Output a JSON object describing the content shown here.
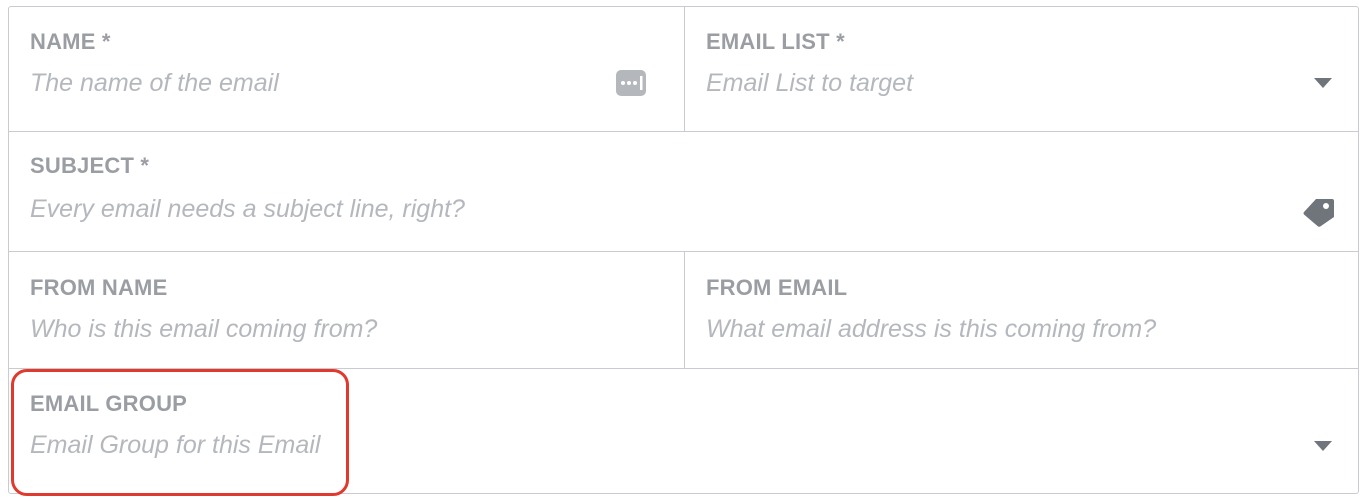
{
  "form": {
    "name": {
      "label": "NAME *",
      "placeholder": "The name of the email",
      "icon": "text-field-icon"
    },
    "email_list": {
      "label": "EMAIL LIST *",
      "placeholder": "Email List to target",
      "icon": "chevron-down-icon"
    },
    "subject": {
      "label": "SUBJECT *",
      "placeholder": "Every email needs a subject line, right?",
      "icon": "tag-icon"
    },
    "from_name": {
      "label": "FROM NAME",
      "placeholder": "Who is this email coming from?"
    },
    "from_email": {
      "label": "FROM EMAIL",
      "placeholder": "What email address is this coming from?"
    },
    "email_group": {
      "label": "EMAIL GROUP",
      "placeholder": "Email Group for this Email",
      "icon": "chevron-down-icon"
    }
  },
  "colors": {
    "border": "#c8ccd0",
    "label": "#9a9ea3",
    "placeholder": "#b4b8bd",
    "icon": "#6f757b",
    "highlight": "#e0392e"
  }
}
